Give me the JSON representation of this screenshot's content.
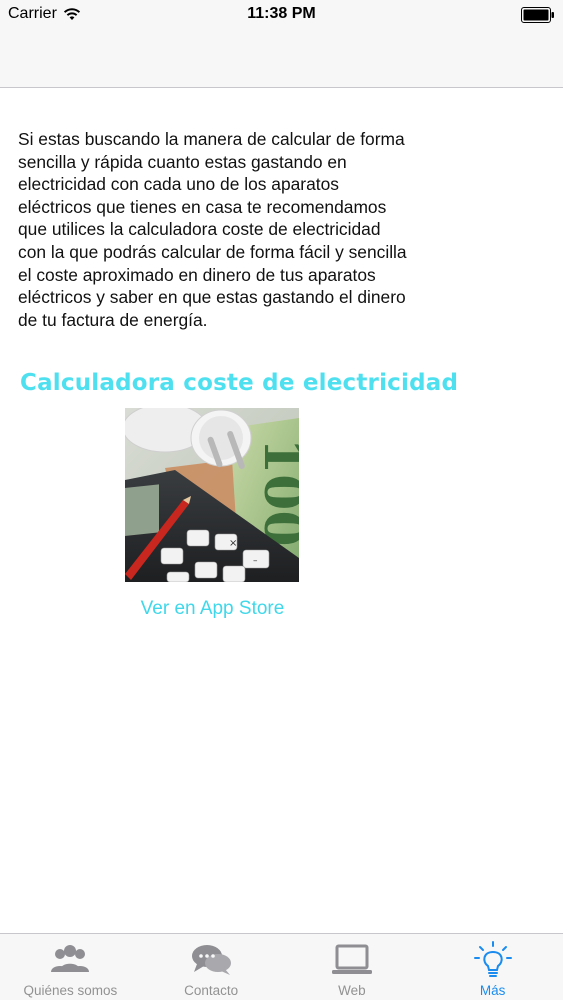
{
  "status_bar": {
    "carrier": "Carrier",
    "time": "11:38 PM",
    "wifi_icon": "wifi-icon",
    "battery_icon": "battery-icon"
  },
  "content": {
    "intro_text": "Si estas buscando la manera de calcular de forma sencilla y rápida cuanto estas gastando en electricidad con cada uno de los aparatos eléctricos que tienes en casa te recomendamos que utilices la calculadora coste de electricidad con la que podrás calcular de forma fácil y sencilla el coste aproximado en dinero de tus aparatos eléctricos y saber en que estas gastando el dinero de tu factura de energía.",
    "promo_title": "Calculadora coste de electricidad",
    "banknote_text": "100",
    "app_store_link": "Ver en App Store"
  },
  "tab_bar": {
    "items": [
      {
        "label": "Quiénes somos",
        "icon": "people-icon",
        "active": false
      },
      {
        "label": "Contacto",
        "icon": "chat-bubbles-icon",
        "active": false
      },
      {
        "label": "Web",
        "icon": "laptop-icon",
        "active": false
      },
      {
        "label": "Más",
        "icon": "lightbulb-icon",
        "active": true
      }
    ]
  },
  "colors": {
    "accent_cyan": "#4fe0f0",
    "tab_active": "#1a8cf0",
    "tab_inactive": "#929292"
  }
}
